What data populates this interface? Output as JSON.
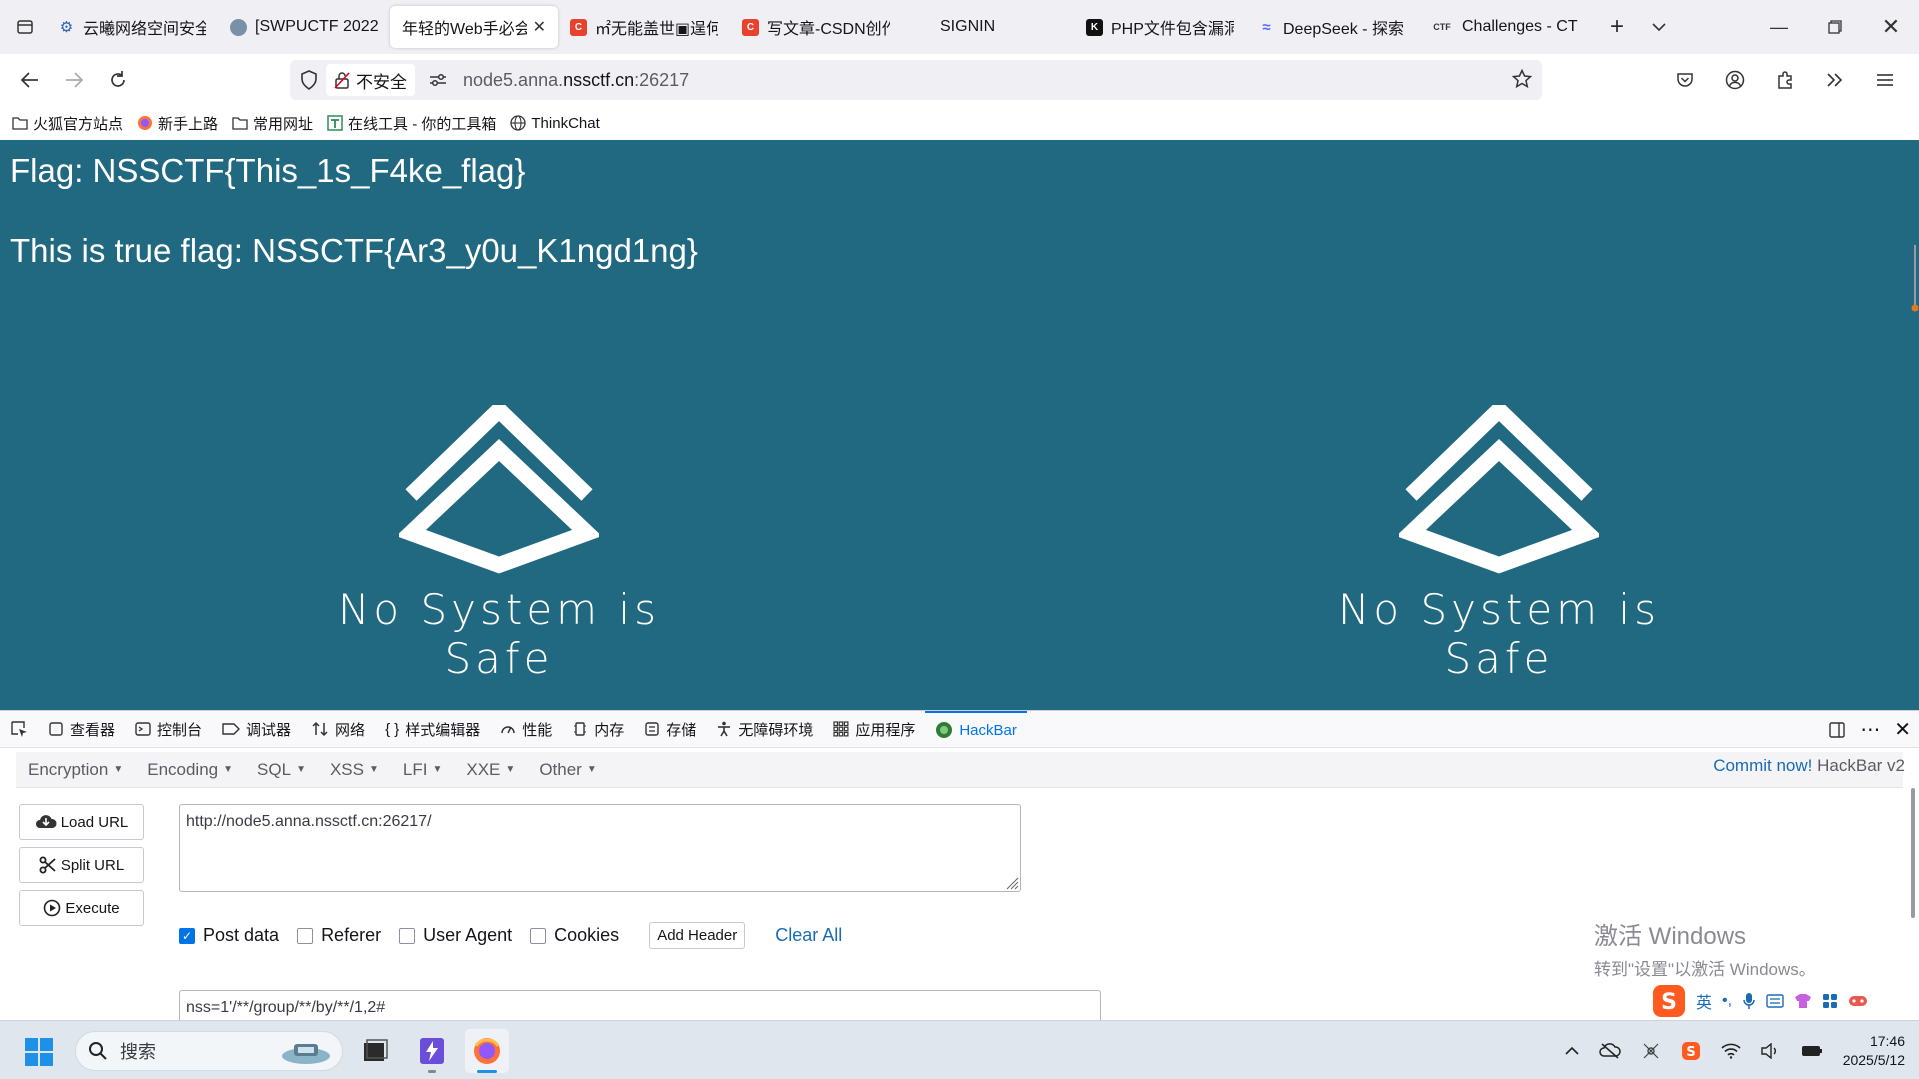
{
  "tabs": [
    {
      "title": "云曦网络空间安全",
      "icon_color": "#2a5db0",
      "icon": "gear-icon"
    },
    {
      "title": "[SWPUCTF 2022",
      "icon_color": "#7a8fa8",
      "icon": "cloud-icon"
    },
    {
      "title": "年轻的Web手必会",
      "icon_color": "#ffffff",
      "icon": "none",
      "active": true
    },
    {
      "title": "㎡无能盖世▣逞何",
      "icon_color": "#e8412c",
      "icon": "csdn-icon",
      "glyph": "C"
    },
    {
      "title": "写文章-CSDN创作",
      "icon_color": "#e8412c",
      "icon": "csdn-icon",
      "glyph": "C"
    },
    {
      "title": "SIGNIN",
      "icon_color": "",
      "icon": "none"
    },
    {
      "title": "PHP文件包含漏洞",
      "icon_color": "#111111",
      "icon": "k-icon",
      "glyph": "K"
    },
    {
      "title": "DeepSeek - 探索",
      "icon_color": "#4d6bfe",
      "icon": "whale-icon"
    },
    {
      "title": "Challenges - CTF",
      "icon_color": "",
      "icon": "ctf-icon",
      "glyph": "CTF"
    }
  ],
  "nav": {
    "insecure_label": "不安全",
    "url_prefix": "node5.anna.",
    "url_domain": "nssctf.cn",
    "url_suffix": ":26217"
  },
  "bookmarks": [
    {
      "label": "火狐官方站点",
      "icon": "folder-icon"
    },
    {
      "label": "新手上路",
      "icon": "firefox-icon"
    },
    {
      "label": "常用网址",
      "icon": "folder-icon"
    },
    {
      "label": "在线工具 - 你的工具箱",
      "icon": "tool-icon"
    },
    {
      "label": "ThinkChat",
      "icon": "globe-icon"
    }
  ],
  "content": {
    "flag1": "Flag: NSSCTF{This_1s_F4ke_flag}",
    "flag2": "This is true flag: NSSCTF{Ar3_y0u_K1ngd1ng}",
    "logo_caption": "No System is Safe",
    "bg_color": "#216980"
  },
  "devtools": {
    "tabs": [
      {
        "label": "查看器",
        "icon": "inspector-icon"
      },
      {
        "label": "控制台",
        "icon": "console-icon"
      },
      {
        "label": "调试器",
        "icon": "debugger-icon"
      },
      {
        "label": "网络",
        "icon": "network-icon"
      },
      {
        "label": "样式编辑器",
        "icon": "style-editor-icon"
      },
      {
        "label": "性能",
        "icon": "performance-icon"
      },
      {
        "label": "内存",
        "icon": "memory-icon"
      },
      {
        "label": "存储",
        "icon": "storage-icon"
      },
      {
        "label": "无障碍环境",
        "icon": "accessibility-icon"
      },
      {
        "label": "应用程序",
        "icon": "application-icon"
      },
      {
        "label": "HackBar",
        "icon": "hackbar-icon",
        "active": true
      }
    ]
  },
  "hackbar": {
    "menu": [
      "Encryption",
      "Encoding",
      "SQL",
      "XSS",
      "LFI",
      "XXE",
      "Other"
    ],
    "commit_link": "Commit now!",
    "commit_version": "HackBar v2",
    "load_url": "Load URL",
    "split_url": "Split URL",
    "execute": "Execute",
    "url_value": "http://node5.anna.nssctf.cn:26217/",
    "options": [
      {
        "label": "Post data",
        "checked": true
      },
      {
        "label": "Referer",
        "checked": false
      },
      {
        "label": "User Agent",
        "checked": false
      },
      {
        "label": "Cookies",
        "checked": false
      }
    ],
    "add_header": "Add Header",
    "clear_all": "Clear All",
    "post_value": "nss=1'/**/group/**/by/**/1,2#"
  },
  "watermark": {
    "line1": "激活 Windows",
    "line2": "转到\"设置\"以激活 Windows。"
  },
  "ime": {
    "lang": "英"
  },
  "taskbar": {
    "search_placeholder": "搜索",
    "time": "17:46",
    "date": "2025/5/12"
  }
}
